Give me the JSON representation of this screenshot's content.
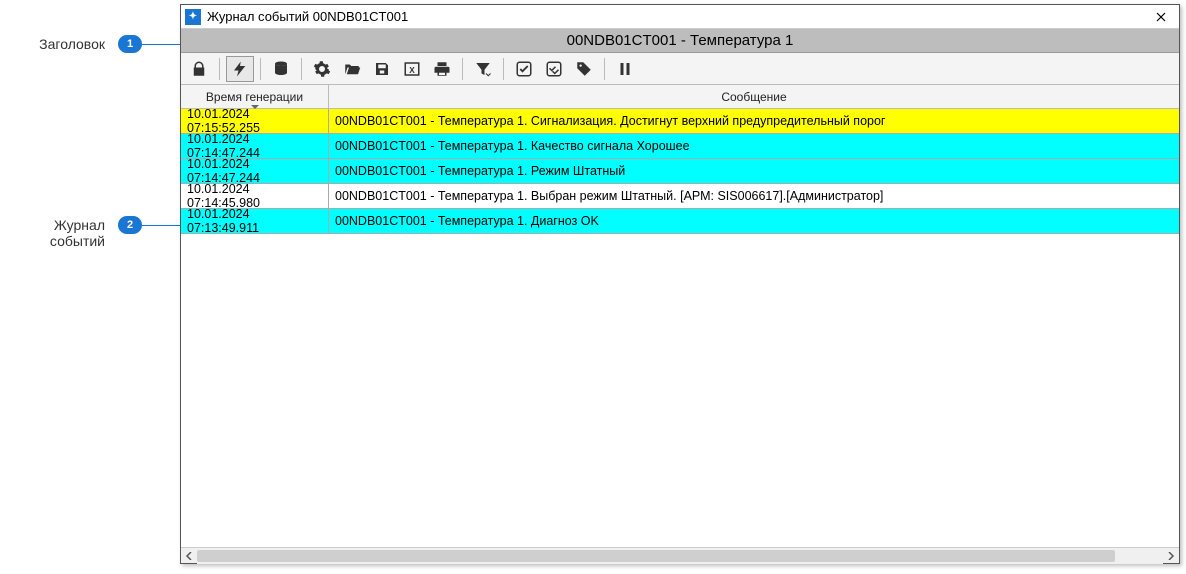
{
  "callouts": {
    "c1": {
      "label": "Заголовок",
      "num": "1"
    },
    "c2": {
      "label": "Журнал событий",
      "num": "2"
    }
  },
  "window": {
    "title": "Журнал событий 00NDB01CT001",
    "close_tooltip": "Close"
  },
  "header": {
    "subject": "00NDB01CT001 - Температура 1"
  },
  "toolbar": {
    "icons": {
      "lock": "lock",
      "bolt": "bolt",
      "db": "database",
      "gear": "gear",
      "open": "folder-open",
      "save": "save",
      "excel": "excel",
      "print": "print",
      "filter": "filter",
      "ack": "ack-check",
      "ack_all": "ack-check-all",
      "tag": "tag",
      "pause": "pause"
    }
  },
  "columns": {
    "time": "Время генерации",
    "message": "Сообщение"
  },
  "rows": [
    {
      "time": "10.01.2024 07:15:52.255",
      "msg": "00NDB01CT001 - Температура 1. Сигнализация. Достигнут верхний предупредительный порог",
      "kind": "yellow"
    },
    {
      "time": "10.01.2024 07:14:47.244",
      "msg": "00NDB01CT001 - Температура 1. Качество сигнала Хорошее",
      "kind": "cyan"
    },
    {
      "time": "10.01.2024 07:14:47.244",
      "msg": "00NDB01CT001 - Температура 1. Режим Штатный",
      "kind": "cyan"
    },
    {
      "time": "10.01.2024 07:14:45.980",
      "msg": "00NDB01CT001 - Температура 1. Выбран режим Штатный. [АРМ: SIS006617].[Администратор]",
      "kind": "white"
    },
    {
      "time": "10.01.2024 07:13:49.911",
      "msg": "00NDB01CT001 - Температура 1. Диагноз OK",
      "kind": "cyan"
    }
  ]
}
